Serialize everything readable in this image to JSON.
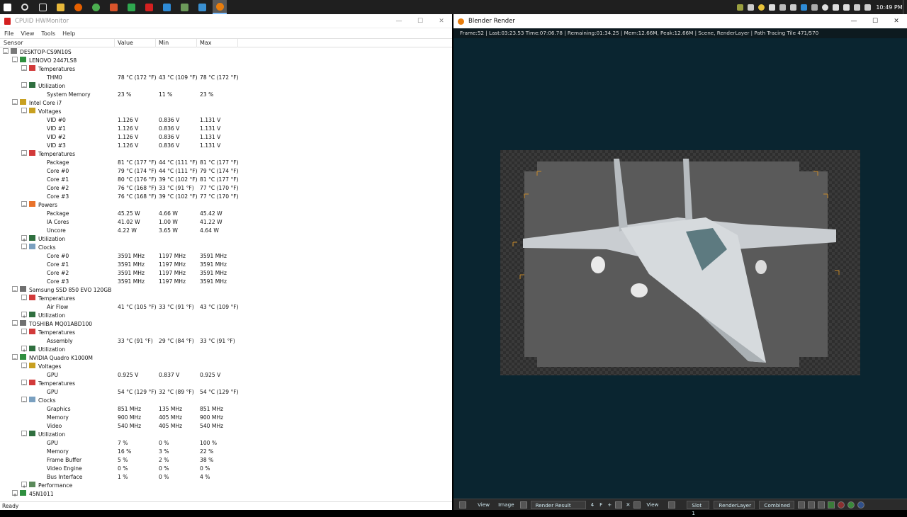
{
  "taskbar": {
    "clock": "10:49 PM"
  },
  "hwmonitor": {
    "title": "CPUID HWMonitor",
    "menu": [
      "File",
      "View",
      "Tools",
      "Help"
    ],
    "columns": [
      "Sensor",
      "Value",
      "Min",
      "Max"
    ],
    "status": "Ready",
    "rows": [
      {
        "d": 0,
        "e": "-",
        "i": "pc",
        "name": "DESKTOP-CS9N10S"
      },
      {
        "d": 1,
        "e": "-",
        "i": "board",
        "name": "LENOVO 2447LS8"
      },
      {
        "d": 2,
        "e": "-",
        "i": "temp",
        "name": "Temperatures"
      },
      {
        "d": 3,
        "name": "THM0",
        "v": "78 °C  (172 °F)",
        "min": "43 °C  (109 °F)",
        "max": "78 °C  (172 °F)"
      },
      {
        "d": 2,
        "e": "-",
        "i": "util",
        "name": "Utilization"
      },
      {
        "d": 3,
        "name": "System Memory",
        "v": "23 %",
        "min": "11 %",
        "max": "23 %"
      },
      {
        "d": 1,
        "e": "-",
        "i": "cpu",
        "name": "Intel Core i7"
      },
      {
        "d": 2,
        "e": "-",
        "i": "volt",
        "name": "Voltages"
      },
      {
        "d": 3,
        "name": "VID #0",
        "v": "1.126 V",
        "min": "0.836 V",
        "max": "1.131 V"
      },
      {
        "d": 3,
        "name": "VID #1",
        "v": "1.126 V",
        "min": "0.836 V",
        "max": "1.131 V"
      },
      {
        "d": 3,
        "name": "VID #2",
        "v": "1.126 V",
        "min": "0.836 V",
        "max": "1.131 V"
      },
      {
        "d": 3,
        "name": "VID #3",
        "v": "1.126 V",
        "min": "0.836 V",
        "max": "1.131 V"
      },
      {
        "d": 2,
        "e": "-",
        "i": "temp",
        "name": "Temperatures"
      },
      {
        "d": 3,
        "name": "Package",
        "v": "81 °C  (177 °F)",
        "min": "44 °C  (111 °F)",
        "max": "81 °C  (177 °F)"
      },
      {
        "d": 3,
        "name": "Core #0",
        "v": "79 °C  (174 °F)",
        "min": "44 °C  (111 °F)",
        "max": "79 °C  (174 °F)"
      },
      {
        "d": 3,
        "name": "Core #1",
        "v": "80 °C  (176 °F)",
        "min": "39 °C  (102 °F)",
        "max": "81 °C  (177 °F)"
      },
      {
        "d": 3,
        "name": "Core #2",
        "v": "76 °C  (168 °F)",
        "min": "33 °C  (91 °F)",
        "max": "77 °C  (170 °F)"
      },
      {
        "d": 3,
        "name": "Core #3",
        "v": "76 °C  (168 °F)",
        "min": "39 °C  (102 °F)",
        "max": "77 °C  (170 °F)"
      },
      {
        "d": 2,
        "e": "-",
        "i": "power",
        "name": "Powers"
      },
      {
        "d": 3,
        "name": "Package",
        "v": "45.25 W",
        "min": "4.66 W",
        "max": "45.42 W"
      },
      {
        "d": 3,
        "name": "IA Cores",
        "v": "41.02 W",
        "min": "1.00 W",
        "max": "41.22 W"
      },
      {
        "d": 3,
        "name": "Uncore",
        "v": "4.22 W",
        "min": "3.65 W",
        "max": "4.64 W"
      },
      {
        "d": 2,
        "e": "+",
        "i": "util",
        "name": "Utilization"
      },
      {
        "d": 2,
        "e": "-",
        "i": "clock",
        "name": "Clocks"
      },
      {
        "d": 3,
        "name": "Core #0",
        "v": "3591 MHz",
        "min": "1197 MHz",
        "max": "3591 MHz"
      },
      {
        "d": 3,
        "name": "Core #1",
        "v": "3591 MHz",
        "min": "1197 MHz",
        "max": "3591 MHz"
      },
      {
        "d": 3,
        "name": "Core #2",
        "v": "3591 MHz",
        "min": "1197 MHz",
        "max": "3591 MHz"
      },
      {
        "d": 3,
        "name": "Core #3",
        "v": "3591 MHz",
        "min": "1197 MHz",
        "max": "3591 MHz"
      },
      {
        "d": 1,
        "e": "-",
        "i": "disk",
        "name": "Samsung SSD 850 EVO 120GB"
      },
      {
        "d": 2,
        "e": "-",
        "i": "temp",
        "name": "Temperatures"
      },
      {
        "d": 3,
        "name": "Air Flow",
        "v": "41 °C  (105 °F)",
        "min": "33 °C  (91 °F)",
        "max": "43 °C  (109 °F)"
      },
      {
        "d": 2,
        "e": "+",
        "i": "util",
        "name": "Utilization"
      },
      {
        "d": 1,
        "e": "-",
        "i": "disk",
        "name": "TOSHIBA MQ01ABD100"
      },
      {
        "d": 2,
        "e": "-",
        "i": "temp",
        "name": "Temperatures"
      },
      {
        "d": 3,
        "name": "Assembly",
        "v": "33 °C  (91 °F)",
        "min": "29 °C  (84 °F)",
        "max": "33 °C  (91 °F)"
      },
      {
        "d": 2,
        "e": "+",
        "i": "util",
        "name": "Utilization"
      },
      {
        "d": 1,
        "e": "-",
        "i": "gpu",
        "name": "NVIDIA Quadro K1000M"
      },
      {
        "d": 2,
        "e": "-",
        "i": "volt",
        "name": "Voltages"
      },
      {
        "d": 3,
        "name": "GPU",
        "v": "0.925 V",
        "min": "0.837 V",
        "max": "0.925 V"
      },
      {
        "d": 2,
        "e": "-",
        "i": "temp",
        "name": "Temperatures"
      },
      {
        "d": 3,
        "name": "GPU",
        "v": "54 °C  (129 °F)",
        "min": "32 °C  (89 °F)",
        "max": "54 °C  (129 °F)"
      },
      {
        "d": 2,
        "e": "-",
        "i": "clock",
        "name": "Clocks"
      },
      {
        "d": 3,
        "name": "Graphics",
        "v": "851 MHz",
        "min": "135 MHz",
        "max": "851 MHz"
      },
      {
        "d": 3,
        "name": "Memory",
        "v": "900 MHz",
        "min": "405 MHz",
        "max": "900 MHz"
      },
      {
        "d": 3,
        "name": "Video",
        "v": "540 MHz",
        "min": "405 MHz",
        "max": "540 MHz"
      },
      {
        "d": 2,
        "e": "-",
        "i": "util",
        "name": "Utilization"
      },
      {
        "d": 3,
        "name": "GPU",
        "v": "7 %",
        "min": "0 %",
        "max": "100 %"
      },
      {
        "d": 3,
        "name": "Memory",
        "v": "16 %",
        "min": "3 %",
        "max": "22 %"
      },
      {
        "d": 3,
        "name": "Frame Buffer",
        "v": "5 %",
        "min": "2 %",
        "max": "38 %"
      },
      {
        "d": 3,
        "name": "Video Engine",
        "v": "0 %",
        "min": "0 %",
        "max": "0 %"
      },
      {
        "d": 3,
        "name": "Bus Interface",
        "v": "1 %",
        "min": "0 %",
        "max": "4 %"
      },
      {
        "d": 2,
        "e": "+",
        "i": "perf",
        "name": "Performance"
      },
      {
        "d": 1,
        "e": "+",
        "i": "board",
        "name": "45N1011"
      }
    ]
  },
  "blender": {
    "title": "Blender Render",
    "info": "Frame:52 | Last:03:23.53 Time:07:06.78 | Remaining:01:34.25 | Mem:12.66M, Peak:12.66M | Scene, RenderLayer | Path Tracing Tile 471/570",
    "footer": {
      "view": "View",
      "image": "Image",
      "result": "Render Result",
      "num": "4",
      "f": "F",
      "view2": "View",
      "slot": "Slot 1",
      "layer": "RenderLayer",
      "pass": "Combined"
    }
  }
}
